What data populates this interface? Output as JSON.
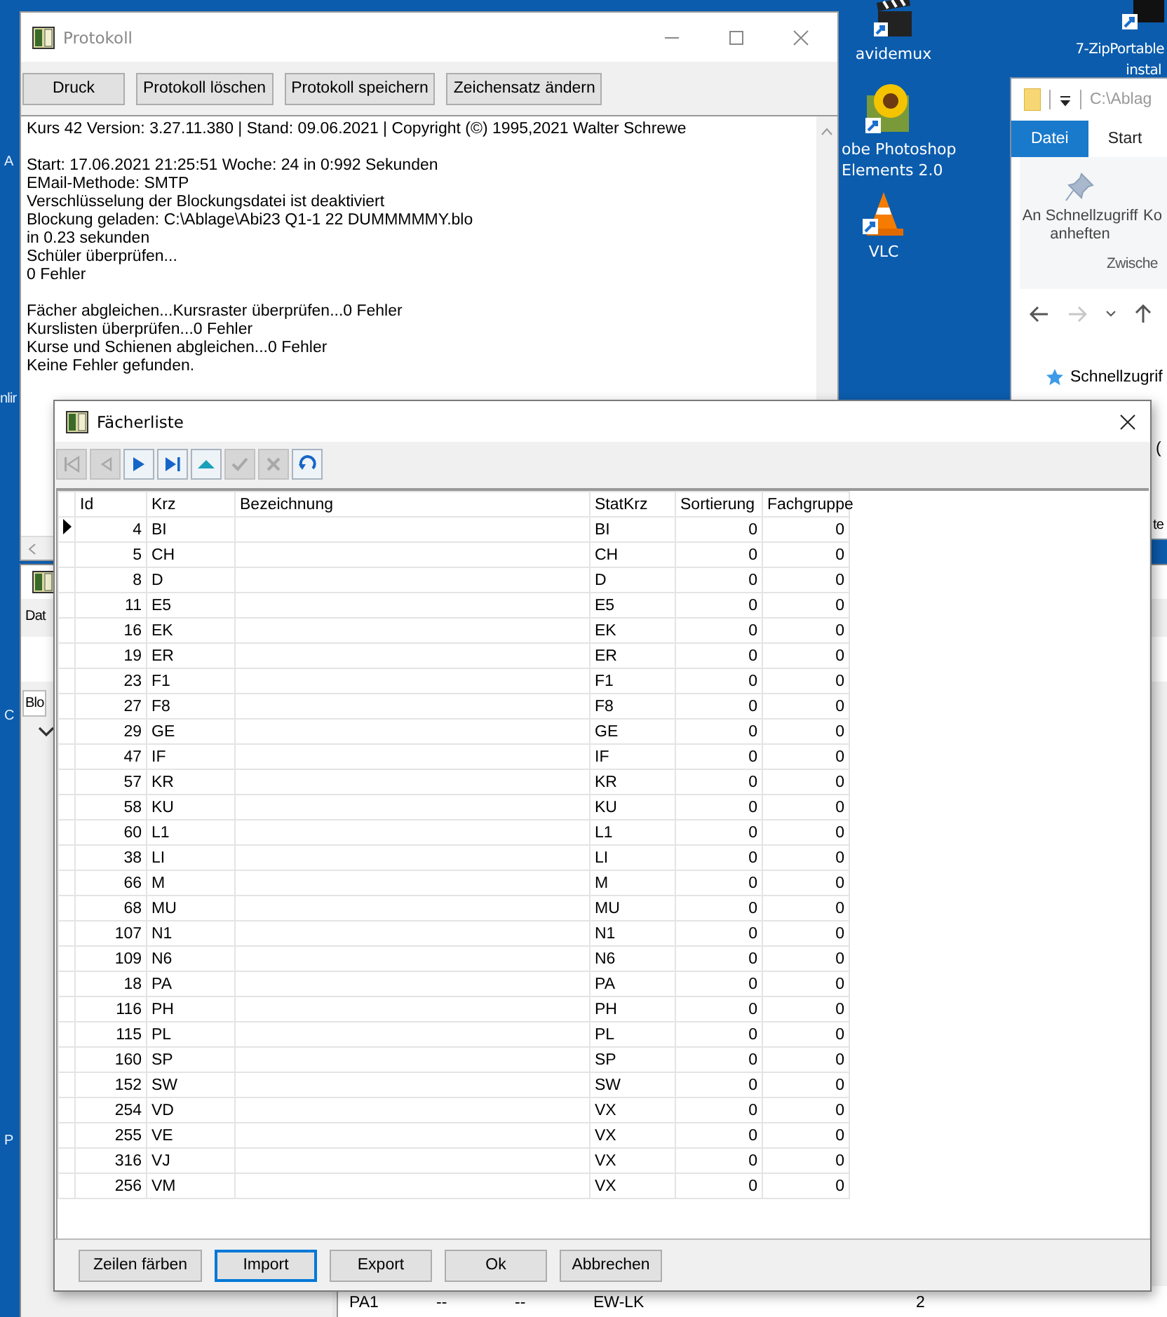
{
  "desktop": {
    "icons": [
      {
        "kind": "clapper",
        "label_lines": [
          "avidemux"
        ]
      },
      {
        "kind": "archive",
        "label_lines": [
          "7-ZipPortable",
          "instal"
        ]
      },
      {
        "kind": "sunflower",
        "label_lines": [
          "obe Photoshop",
          "Elements 2.0"
        ]
      },
      {
        "kind": "cone",
        "label_lines": [
          "VLC"
        ]
      }
    ],
    "edge_labels": [
      "A",
      "nlir",
      "C",
      "P"
    ]
  },
  "explorer": {
    "path": "C:\\Ablag",
    "tabs": [
      {
        "label": "Datei",
        "selected": true
      },
      {
        "label": "Start",
        "selected": false
      }
    ],
    "ribbon_button": [
      "An Schnellzugriff",
      "anheften"
    ],
    "ribbon_next": "Ko",
    "group_label": "Zwische",
    "nav_item": "Schnellzugrif",
    "fragments": [
      "(",
      "te"
    ]
  },
  "protokoll": {
    "title": "Protokoll",
    "buttons": [
      "Druck",
      "Protokoll löschen",
      "Protokoll speichern",
      "Zeichensatz ändern"
    ],
    "log": [
      [
        "Kurs 42 Version: 3.27.11.380 | Stand: 09.06.2021 | Copyright (©) 1995,2021 Walter Schrewe"
      ],
      [
        "Start: 17.06.2021 21:25:51 Woche: 24 in 0:992 Sekunden",
        "EMail-Methode: SMTP",
        "Verschlüsselung der Blockungsdatei ist deaktiviert",
        "Blockung geladen: C:\\Ablage\\Abi23 Q1-1 22 DUMMMMMY.blo",
        "in  0.23 sekunden",
        "Schüler überprüfen...",
        "0 Fehler"
      ],
      [
        "Fächer abgleichen...Kursraster überprüfen...0 Fehler",
        "Kurslisten überprüfen...0 Fehler",
        "Kurse und Schienen abgleichen...0 Fehler",
        "Keine Fehler gefunden."
      ]
    ]
  },
  "back_window": {
    "menu": "Dat",
    "tab": "Blo",
    "row": [
      "PA1",
      "--",
      "--",
      "EW-LK",
      "2"
    ]
  },
  "faecherliste": {
    "title": "Fächerliste",
    "nav_buttons": [
      {
        "kind": "first",
        "disabled": true
      },
      {
        "kind": "prior",
        "disabled": true
      },
      {
        "kind": "next",
        "disabled": false
      },
      {
        "kind": "last",
        "disabled": false
      },
      {
        "kind": "insert",
        "disabled": false
      },
      {
        "kind": "post",
        "disabled": true
      },
      {
        "kind": "cancel",
        "disabled": true
      },
      {
        "kind": "refresh",
        "disabled": false
      }
    ],
    "columns": [
      "Id",
      "Krz",
      "Bezeichnung",
      "StatKrz",
      "Sortierung",
      "Fachgruppe"
    ],
    "rows": [
      {
        "id": "4",
        "krz": "BI",
        "statkrz": "BI",
        "sortierung": "0",
        "fachgruppe": "0",
        "selected": true
      },
      {
        "id": "5",
        "krz": "CH",
        "statkrz": "CH",
        "sortierung": "0",
        "fachgruppe": "0",
        "selected": false
      },
      {
        "id": "8",
        "krz": "D",
        "statkrz": "D",
        "sortierung": "0",
        "fachgruppe": "0",
        "selected": false
      },
      {
        "id": "11",
        "krz": "E5",
        "statkrz": "E5",
        "sortierung": "0",
        "fachgruppe": "0",
        "selected": false
      },
      {
        "id": "16",
        "krz": "EK",
        "statkrz": "EK",
        "sortierung": "0",
        "fachgruppe": "0",
        "selected": false
      },
      {
        "id": "19",
        "krz": "ER",
        "statkrz": "ER",
        "sortierung": "0",
        "fachgruppe": "0",
        "selected": false
      },
      {
        "id": "23",
        "krz": "F1",
        "statkrz": "F1",
        "sortierung": "0",
        "fachgruppe": "0",
        "selected": false
      },
      {
        "id": "27",
        "krz": "F8",
        "statkrz": "F8",
        "sortierung": "0",
        "fachgruppe": "0",
        "selected": false
      },
      {
        "id": "29",
        "krz": "GE",
        "statkrz": "GE",
        "sortierung": "0",
        "fachgruppe": "0",
        "selected": false
      },
      {
        "id": "47",
        "krz": "IF",
        "statkrz": "IF",
        "sortierung": "0",
        "fachgruppe": "0",
        "selected": false
      },
      {
        "id": "57",
        "krz": "KR",
        "statkrz": "KR",
        "sortierung": "0",
        "fachgruppe": "0",
        "selected": false
      },
      {
        "id": "58",
        "krz": "KU",
        "statkrz": "KU",
        "sortierung": "0",
        "fachgruppe": "0",
        "selected": false
      },
      {
        "id": "60",
        "krz": "L1",
        "statkrz": "L1",
        "sortierung": "0",
        "fachgruppe": "0",
        "selected": false
      },
      {
        "id": "38",
        "krz": "LI",
        "statkrz": "LI",
        "sortierung": "0",
        "fachgruppe": "0",
        "selected": false
      },
      {
        "id": "66",
        "krz": "M",
        "statkrz": "M",
        "sortierung": "0",
        "fachgruppe": "0",
        "selected": false
      },
      {
        "id": "68",
        "krz": "MU",
        "statkrz": "MU",
        "sortierung": "0",
        "fachgruppe": "0",
        "selected": false
      },
      {
        "id": "107",
        "krz": "N1",
        "statkrz": "N1",
        "sortierung": "0",
        "fachgruppe": "0",
        "selected": false
      },
      {
        "id": "109",
        "krz": "N6",
        "statkrz": "N6",
        "sortierung": "0",
        "fachgruppe": "0",
        "selected": false
      },
      {
        "id": "18",
        "krz": "PA",
        "statkrz": "PA",
        "sortierung": "0",
        "fachgruppe": "0",
        "selected": false
      },
      {
        "id": "116",
        "krz": "PH",
        "statkrz": "PH",
        "sortierung": "0",
        "fachgruppe": "0",
        "selected": false
      },
      {
        "id": "115",
        "krz": "PL",
        "statkrz": "PL",
        "sortierung": "0",
        "fachgruppe": "0",
        "selected": false
      },
      {
        "id": "160",
        "krz": "SP",
        "statkrz": "SP",
        "sortierung": "0",
        "fachgruppe": "0",
        "selected": false
      },
      {
        "id": "152",
        "krz": "SW",
        "statkrz": "SW",
        "sortierung": "0",
        "fachgruppe": "0",
        "selected": false
      },
      {
        "id": "254",
        "krz": "VD",
        "statkrz": "VX",
        "sortierung": "0",
        "fachgruppe": "0",
        "selected": false
      },
      {
        "id": "255",
        "krz": "VE",
        "statkrz": "VX",
        "sortierung": "0",
        "fachgruppe": "0",
        "selected": false
      },
      {
        "id": "316",
        "krz": "VJ",
        "statkrz": "VX",
        "sortierung": "0",
        "fachgruppe": "0",
        "selected": false
      },
      {
        "id": "256",
        "krz": "VM",
        "statkrz": "VX",
        "sortierung": "0",
        "fachgruppe": "0",
        "selected": false
      }
    ],
    "buttons": [
      {
        "label": "Zeilen färben",
        "default": false
      },
      {
        "label": "Import",
        "default": true
      },
      {
        "label": "Export",
        "default": false
      },
      {
        "label": "Ok",
        "default": false
      },
      {
        "label": "Abbrechen",
        "default": false
      }
    ]
  }
}
